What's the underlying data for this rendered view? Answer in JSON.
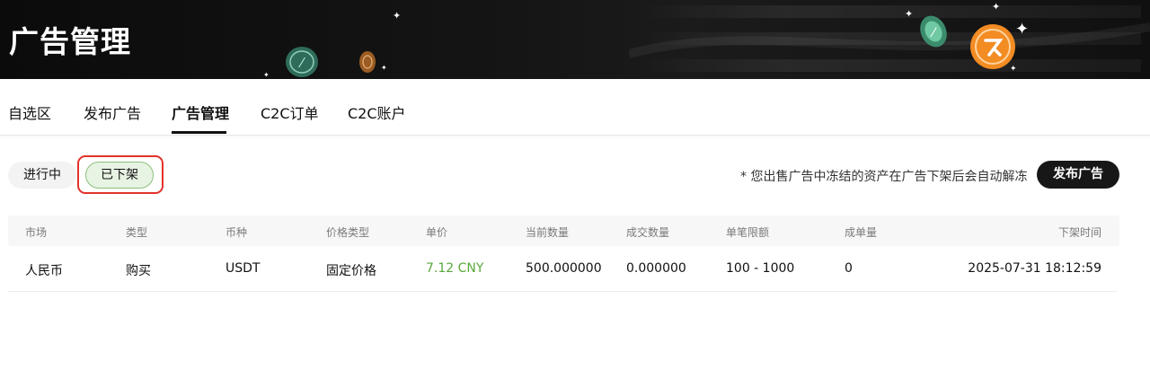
{
  "banner": {
    "title": "广告管理"
  },
  "nav": {
    "tabs": [
      {
        "label": "自选区"
      },
      {
        "label": "发布广告"
      },
      {
        "label": "广告管理"
      },
      {
        "label": "C2C订单"
      },
      {
        "label": "C2C账户"
      }
    ],
    "active_tab": "广告管理"
  },
  "filters": {
    "in_progress": "进行中",
    "removed": "已下架",
    "selected": "已下架"
  },
  "notice": "* 您出售广告中冻结的资产在广告下架后会自动解冻",
  "publish_button": "发布广告",
  "table": {
    "headers": [
      "市场",
      "类型",
      "币种",
      "价格类型",
      "单价",
      "当前数量",
      "成交数量",
      "单笔限额",
      "成单量",
      "下架时间"
    ],
    "rows": [
      {
        "market": "人民币",
        "type": "购买",
        "currency": "USDT",
        "price_type": "固定价格",
        "price": "7.12 CNY",
        "current_qty": "500.000000",
        "filled_qty": "0.000000",
        "limit": "100 - 1000",
        "orders": "0",
        "removed_time": "2025-07-31 18:12:59"
      }
    ]
  },
  "colors": {
    "price_green": "#5aa83c",
    "highlight_red": "#e2322a",
    "dark": "#171717"
  }
}
